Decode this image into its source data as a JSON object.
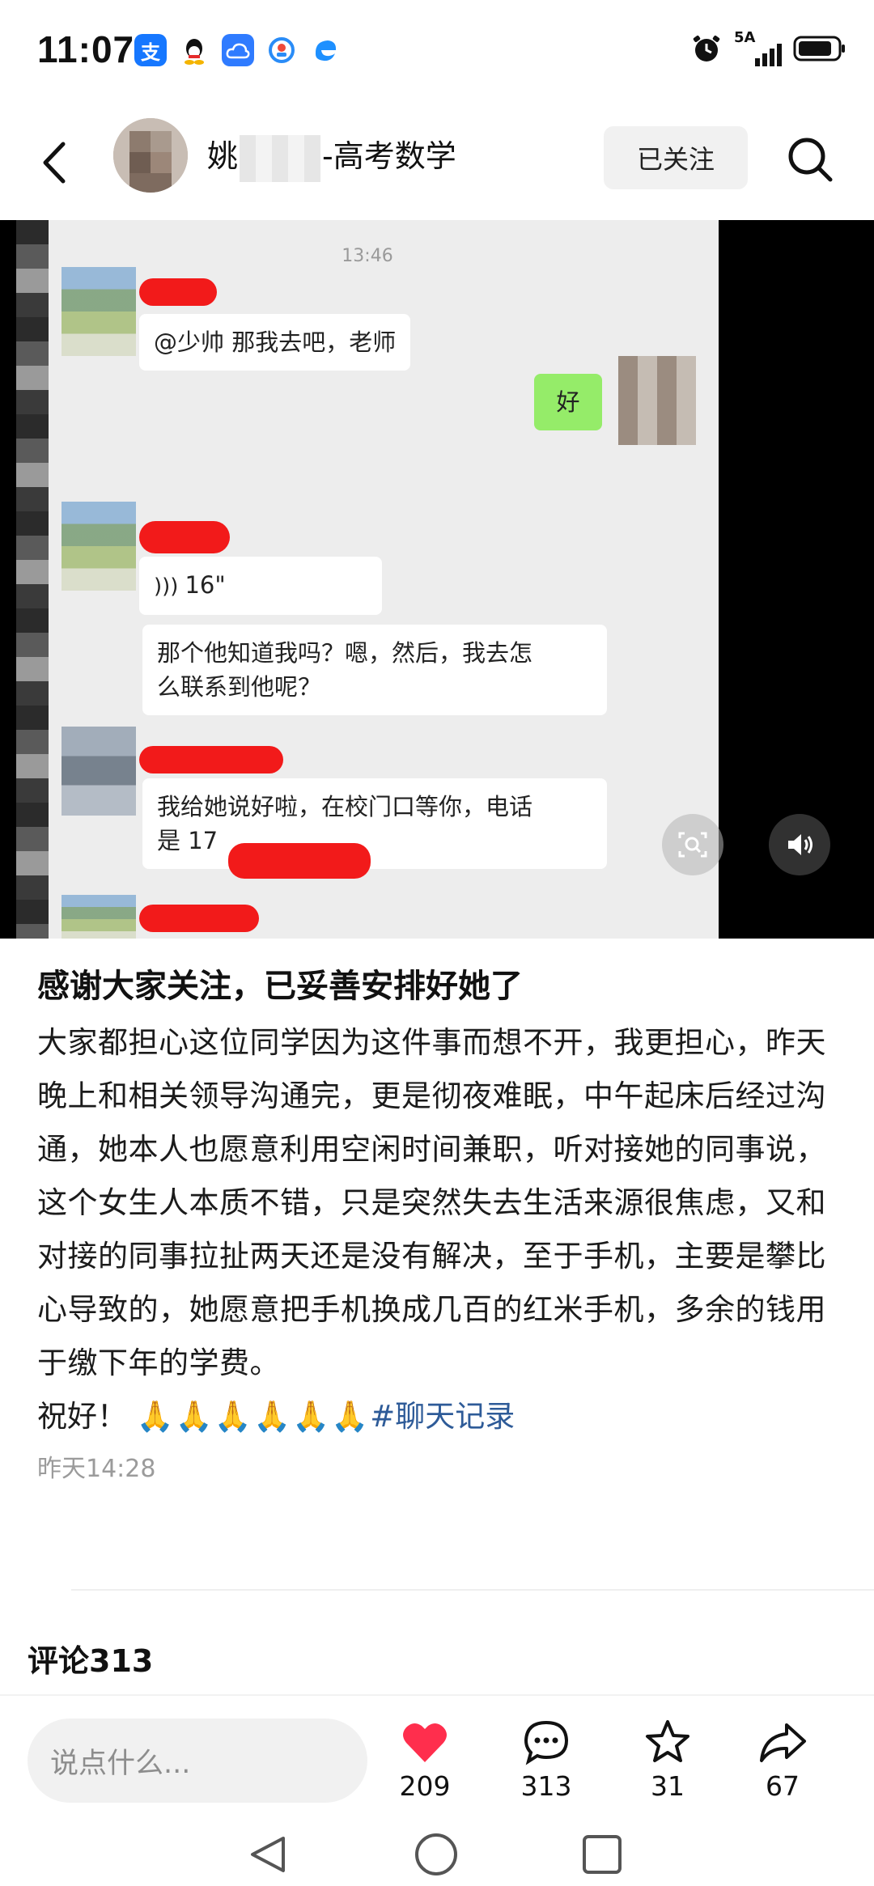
{
  "status_bar": {
    "time": "11:07",
    "network": "5A",
    "app_icons": [
      "alipay-icon",
      "qq-icon",
      "cloud-icon",
      "app-icon",
      "browser-icon"
    ]
  },
  "header": {
    "author_name_prefix": "姚",
    "author_name_suffix": "-高考数学",
    "follow_label": "已关注"
  },
  "chat_screenshot": {
    "timestamp": "13:46",
    "messages": [
      {
        "side": "left",
        "text": "@少帅  那我去吧，老师"
      },
      {
        "side": "right",
        "text": "好"
      },
      {
        "side": "left",
        "text": "16\""
      },
      {
        "side": "left",
        "text_line1": "那个他知道我吗？嗯，然后，我去怎",
        "text_line2": "么联系到他呢？"
      },
      {
        "side": "left",
        "text_line1": "我给她说好啦，在校门口等你，电话",
        "text_line2": "是 17"
      }
    ]
  },
  "post": {
    "title": "感谢大家关注，已妥善安排好她了",
    "body": "大家都担心这位同学因为这件事而想不开，我更担心，昨天晚上和相关领导沟通完，更是彻夜难眠，中午起床后经过沟通，她本人也愿意利用空闲时间兼职，听对接她的同事说，这个女生人本质不错，只是突然失去生活来源很焦虑，又和对接的同事拉扯两天还是没有解决，至于手机，主要是攀比心导致的，她愿意把手机换成几百的红米手机，多余的钱用于缴下年的学费。",
    "closing": "祝好！",
    "emojis": "🙏🙏🙏🙏🙏🙏",
    "tag": "#聊天记录",
    "time": "昨天14:28"
  },
  "comments": {
    "heading": "评论313"
  },
  "bottom_bar": {
    "input_placeholder": "说点什么...",
    "likes": "209",
    "comments": "313",
    "favorites": "31",
    "shares": "67",
    "like_color": "#ff2e4d"
  }
}
